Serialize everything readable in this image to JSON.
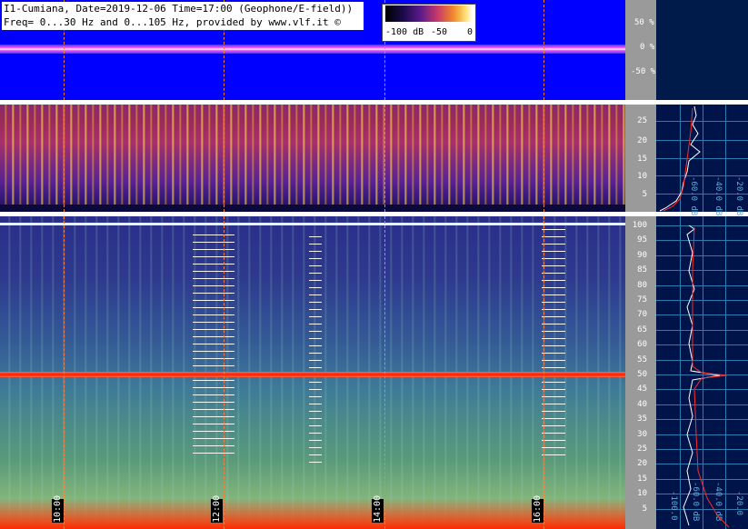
{
  "header": {
    "line1": "I1-Cumiana, Date=2019-12-06 Time=17:00 (Geophone/E-field))",
    "line2": "Freq= 0...30 Hz and 0...105 Hz, provided by www.vlf.it ©"
  },
  "color_scale": {
    "label_min": "-100 dB",
    "label_mid": "-50",
    "label_max": "0"
  },
  "waveform_axis": {
    "ticks": [
      "50 %",
      "0 %",
      "-50 %"
    ]
  },
  "mid_axis": {
    "ticks": [
      "25",
      "20",
      "15",
      "10",
      "5"
    ]
  },
  "low_axis": {
    "ticks": [
      "100",
      "95",
      "90",
      "85",
      "80",
      "75",
      "70",
      "65",
      "60",
      "55",
      "50",
      "45",
      "40",
      "35",
      "30",
      "25",
      "20",
      "15",
      "10",
      "5"
    ]
  },
  "time_markers": [
    "10:00",
    "12:00",
    "14:00",
    "16:00"
  ],
  "right_mid_labels": [
    "-60.0 dB",
    "-40.0 dB",
    "-20.0 dB"
  ],
  "right_low_labels": [
    "-100.0",
    "-60.0 dB",
    "-40.0 dB",
    "-20.0"
  ],
  "colors": {
    "waveform_bg": "#0000ff",
    "hum_line": "#ff1a0a",
    "grid_line": "#ff7a3a",
    "panel_bg": "#00144a"
  }
}
